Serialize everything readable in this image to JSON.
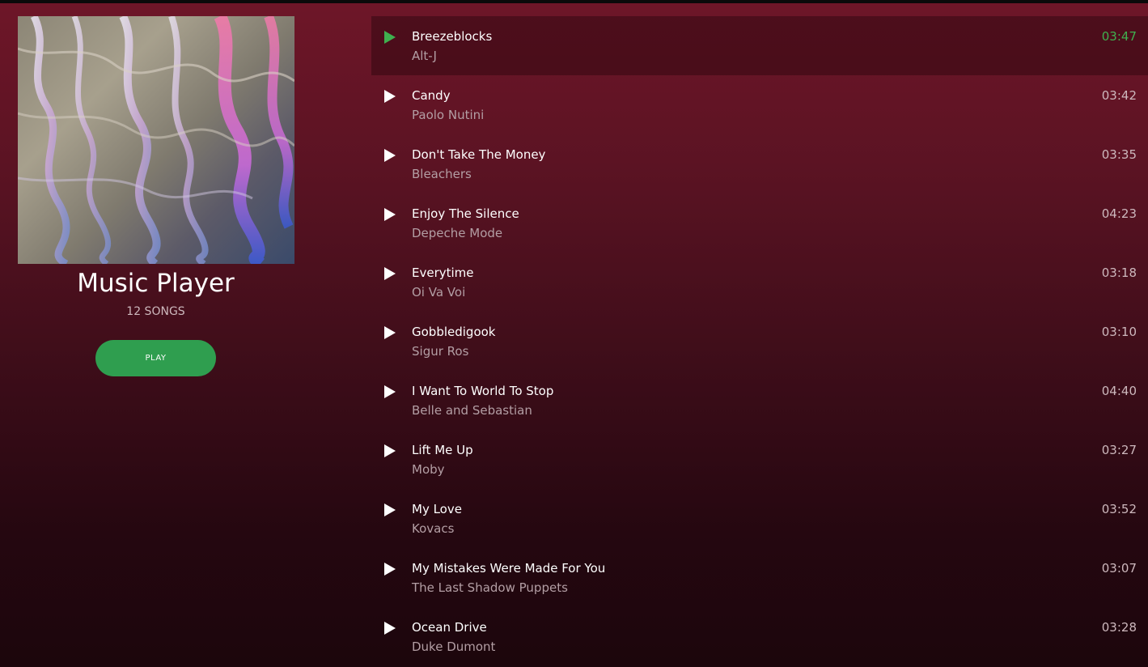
{
  "player": {
    "title": "Music Player",
    "song_count": "12 SONGS",
    "play_label": "PLAY"
  },
  "colors": {
    "accent": "#2f9e4f",
    "active_text": "#3fb04f",
    "bg_top": "#6e1628",
    "bg_bottom": "#1c060c"
  },
  "icons": {
    "play": "play-triangle-icon"
  },
  "tracks": [
    {
      "title": "Breezeblocks",
      "artist": "Alt-J",
      "duration": "03:47"
    },
    {
      "title": "Candy",
      "artist": "Paolo Nutini",
      "duration": "03:42"
    },
    {
      "title": "Don't Take The Money",
      "artist": "Bleachers",
      "duration": "03:35"
    },
    {
      "title": "Enjoy The Silence",
      "artist": "Depeche Mode",
      "duration": "04:23"
    },
    {
      "title": "Everytime",
      "artist": "Oi Va Voi",
      "duration": "03:18"
    },
    {
      "title": "Gobbledigook",
      "artist": "Sigur Ros",
      "duration": "03:10"
    },
    {
      "title": "I Want To World To Stop",
      "artist": "Belle and Sebastian",
      "duration": "04:40"
    },
    {
      "title": "Lift Me Up",
      "artist": "Moby",
      "duration": "03:27"
    },
    {
      "title": "My Love",
      "artist": "Kovacs",
      "duration": "03:52"
    },
    {
      "title": "My Mistakes Were Made For You",
      "artist": "The Last Shadow Puppets",
      "duration": "03:07"
    },
    {
      "title": "Ocean Drive",
      "artist": "Duke Dumont",
      "duration": "03:28"
    }
  ]
}
